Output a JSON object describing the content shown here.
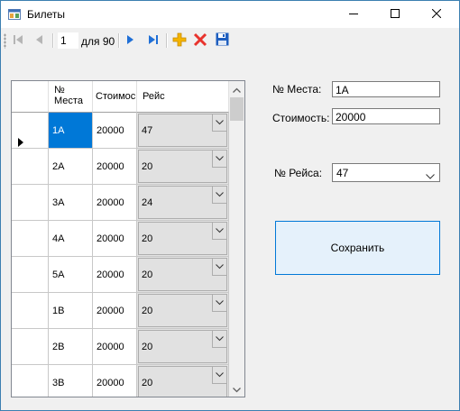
{
  "window": {
    "title": "Билеты"
  },
  "toolbar": {
    "position": "1",
    "of_label": "для 90"
  },
  "grid": {
    "columns": [
      "№ Места",
      "Стоимос",
      "Рейс"
    ],
    "rows": [
      {
        "seat": "1A",
        "cost": "20000",
        "flight": "47"
      },
      {
        "seat": "2A",
        "cost": "20000",
        "flight": "20"
      },
      {
        "seat": "3A",
        "cost": "20000",
        "flight": "24"
      },
      {
        "seat": "4A",
        "cost": "20000",
        "flight": "20"
      },
      {
        "seat": "5A",
        "cost": "20000",
        "flight": "20"
      },
      {
        "seat": "1B",
        "cost": "20000",
        "flight": "20"
      },
      {
        "seat": "2B",
        "cost": "20000",
        "flight": "20"
      },
      {
        "seat": "3B",
        "cost": "20000",
        "flight": "20"
      }
    ]
  },
  "form": {
    "seat_label": "№ Места:",
    "seat_value": "1A",
    "cost_label": "Стоимость:",
    "cost_value": "20000",
    "flight_label": "№ Рейса:",
    "flight_value": "47",
    "save_label": "Сохранить"
  },
  "icons": {
    "first": "move-first-icon",
    "prev": "move-previous-icon",
    "next": "move-next-icon",
    "last": "move-last-icon",
    "add": "add-new-icon",
    "delete": "delete-icon",
    "save": "save-icon"
  },
  "colors": {
    "accent": "#0078d7",
    "nav_blue": "#1f6fd6",
    "add_yellow": "#f4b400",
    "delete_red": "#e8332d"
  }
}
